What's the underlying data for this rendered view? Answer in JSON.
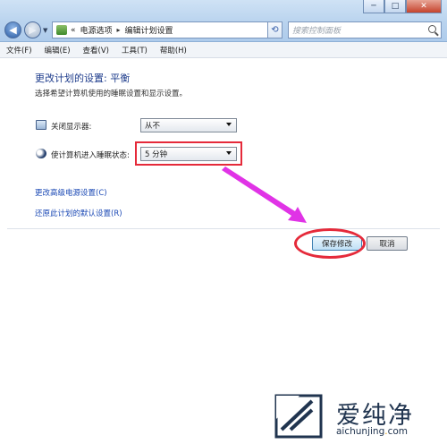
{
  "window": {
    "minimize_glyph": "─",
    "maximize_glyph": "□",
    "close_glyph": "✕"
  },
  "address_bar": {
    "prefix": "«",
    "crumbs": [
      "电源选项",
      "编辑计划设置"
    ],
    "separator": "▸",
    "search_placeholder": "搜索控制面板"
  },
  "menu": [
    "文件(F)",
    "编辑(E)",
    "查看(V)",
    "工具(T)",
    "帮助(H)"
  ],
  "page": {
    "title": "更改计划的设置: 平衡",
    "subtitle": "选择希望计算机使用的睡眠设置和显示设置。",
    "display_off_label": "关闭显示器:",
    "display_off_value": "从不",
    "sleep_label": "使计算机进入睡眠状态:",
    "sleep_value": "5 分钟",
    "link_advanced": "更改高级电源设置(C)",
    "link_restore": "还原此计划的默认设置(R)",
    "save_button": "保存修改",
    "cancel_button": "取消"
  },
  "annotation": {
    "highlight_color": "#e52a3a",
    "arrow_color": "#e033e6"
  },
  "watermark": {
    "brand": "爱纯净",
    "url_part1": "aichunjing",
    "url_dot": ".",
    "url_part2": "com"
  }
}
